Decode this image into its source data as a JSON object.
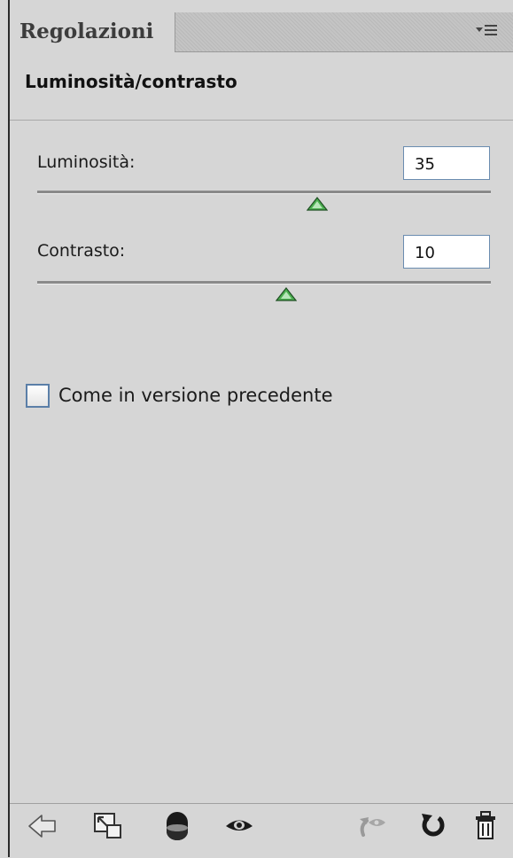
{
  "panel": {
    "tab_label": "Regolazioni",
    "panel_menu_icon": "panel-menu-icon",
    "adjustment_title": "Luminosità/contrasto"
  },
  "controls": {
    "brightness": {
      "label": "Luminosità:",
      "value": "35"
    },
    "contrast": {
      "label": "Contrasto:",
      "value": "10"
    }
  },
  "legacy_option": {
    "label": "Come in versione precedente",
    "checked": false
  },
  "toolbar": {
    "icons": [
      "back-arrow-icon",
      "expand-view-icon",
      "clip-to-layer-icon",
      "visibility-eye-icon",
      "previous-state-icon",
      "reset-icon",
      "trash-icon"
    ]
  },
  "colors": {
    "panel_bg": "#d6d6d6",
    "field_border": "#6a8cb0",
    "slider_thumb": "#4caf50"
  }
}
